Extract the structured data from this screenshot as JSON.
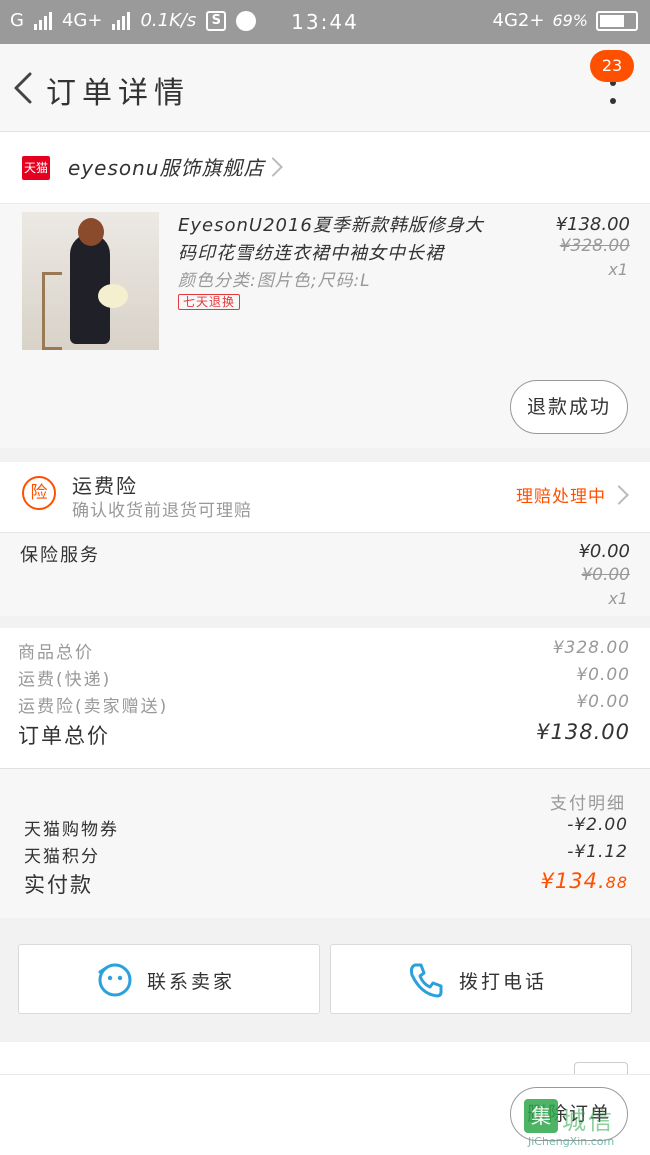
{
  "status_bar": {
    "carrier1": "G",
    "carrier2": "4G+",
    "speed": "0.1K/s",
    "sim_icon": "S",
    "time": "13:44",
    "network": "4G2+",
    "battery": "69%"
  },
  "header": {
    "title": "订单详情",
    "badge_count": "23"
  },
  "store": {
    "logo_text": "天猫",
    "name": "eyesonu服饰旗舰店"
  },
  "product": {
    "name": "EyesonU2016夏季新款韩版修身大码印花雪纺连衣裙中袖女中长裙",
    "sku": "颜色分类:图片色;尺码:L",
    "tag": "七天退换",
    "price": "¥138.00",
    "original_price": "¥328.00",
    "quantity": "x1",
    "refund_button": "退款成功"
  },
  "insurance": {
    "icon_text": "险",
    "title": "运费险",
    "subtitle": "确认收货前退货可理赔",
    "status": "理赔处理中"
  },
  "service": {
    "label": "保险服务",
    "price": "¥0.00",
    "original_price": "¥0.00",
    "quantity": "x1"
  },
  "totals": {
    "rows": [
      {
        "label": "商品总价",
        "value": "¥328.00"
      },
      {
        "label": "运费(快递)",
        "value": "¥0.00"
      },
      {
        "label": "运费险(卖家赠送)",
        "value": "¥0.00"
      }
    ],
    "total_label": "订单总价",
    "total_value": "¥138.00"
  },
  "payment": {
    "detail_link": "支付明细",
    "rows": [
      {
        "label": "天猫购物券",
        "value": "-¥2.00"
      },
      {
        "label": "天猫积分",
        "value": "-¥1.12"
      }
    ],
    "paid_label": "实付款",
    "paid_value_main": "¥134.",
    "paid_value_cents": "88"
  },
  "actions": {
    "contact_seller": "联系卖家",
    "call_phone": "拨打电话"
  },
  "bottom": {
    "delete_order": "删除订单"
  },
  "watermark": {
    "logo": "集",
    "text": "城信",
    "url": "JiChengXin.com"
  },
  "colors": {
    "accent": "#ff5000",
    "tmall_red": "#e4001e",
    "phone_blue": "#2aa0dc"
  }
}
